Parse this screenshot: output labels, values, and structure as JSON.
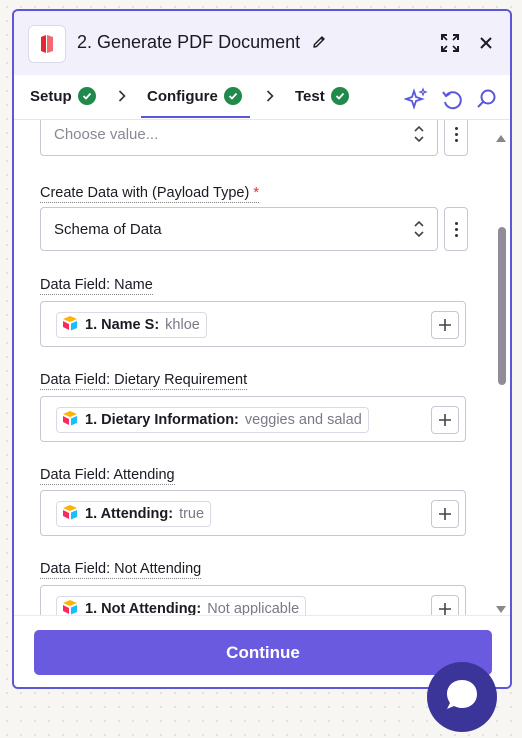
{
  "header": {
    "title": "2. Generate PDF Document",
    "brand_color": "#e3262f"
  },
  "tabs": [
    {
      "label": "Setup",
      "complete": true
    },
    {
      "label": "Configure",
      "complete": true,
      "active": true
    },
    {
      "label": "Test",
      "complete": true
    }
  ],
  "fields": {
    "top_select_placeholder": "Choose value...",
    "payload_type": {
      "label": "Create Data with (Payload Type)",
      "required_mark": "*",
      "value": "Schema of Data"
    },
    "name": {
      "label": "Data Field: Name",
      "pill_key": "1. Name S:",
      "pill_value": "khloe"
    },
    "dietary": {
      "label": "Data Field: Dietary Requirement",
      "pill_key": "1. Dietary Information:",
      "pill_value": "veggies and salad"
    },
    "attending": {
      "label": "Data Field: Attending",
      "pill_key": "1. Attending:",
      "pill_value": "true"
    },
    "not_attending": {
      "label": "Data Field: Not Attending",
      "pill_key": "1. Not Attending:",
      "pill_value": "Not applicable"
    }
  },
  "footer": {
    "continue_label": "Continue"
  },
  "colors": {
    "accent": "#5b57d9",
    "button": "#6a5ae0",
    "success": "#1f8a4c",
    "chat": "#3b3599"
  }
}
